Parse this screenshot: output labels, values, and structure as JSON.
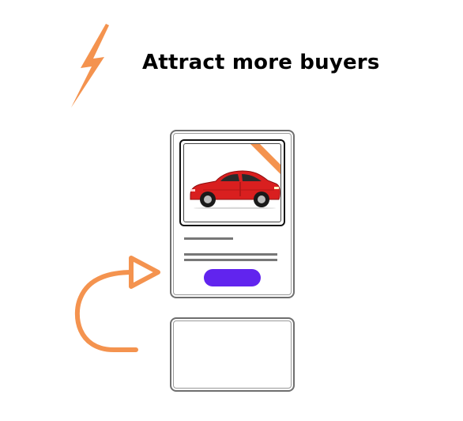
{
  "headline": {
    "text": "Attract more buyers"
  },
  "icons": {
    "bolt": "lightning-bolt-icon",
    "arrow": "curved-arrow-icon",
    "car": "car-icon",
    "badge": "corner-ribbon-icon"
  },
  "colors": {
    "accent_orange": "#F4934F",
    "button_purple": "#6124EE",
    "car_red": "#D91F1F",
    "outline_gray": "#6F6F6F"
  },
  "listing_card": {
    "featured": true
  }
}
